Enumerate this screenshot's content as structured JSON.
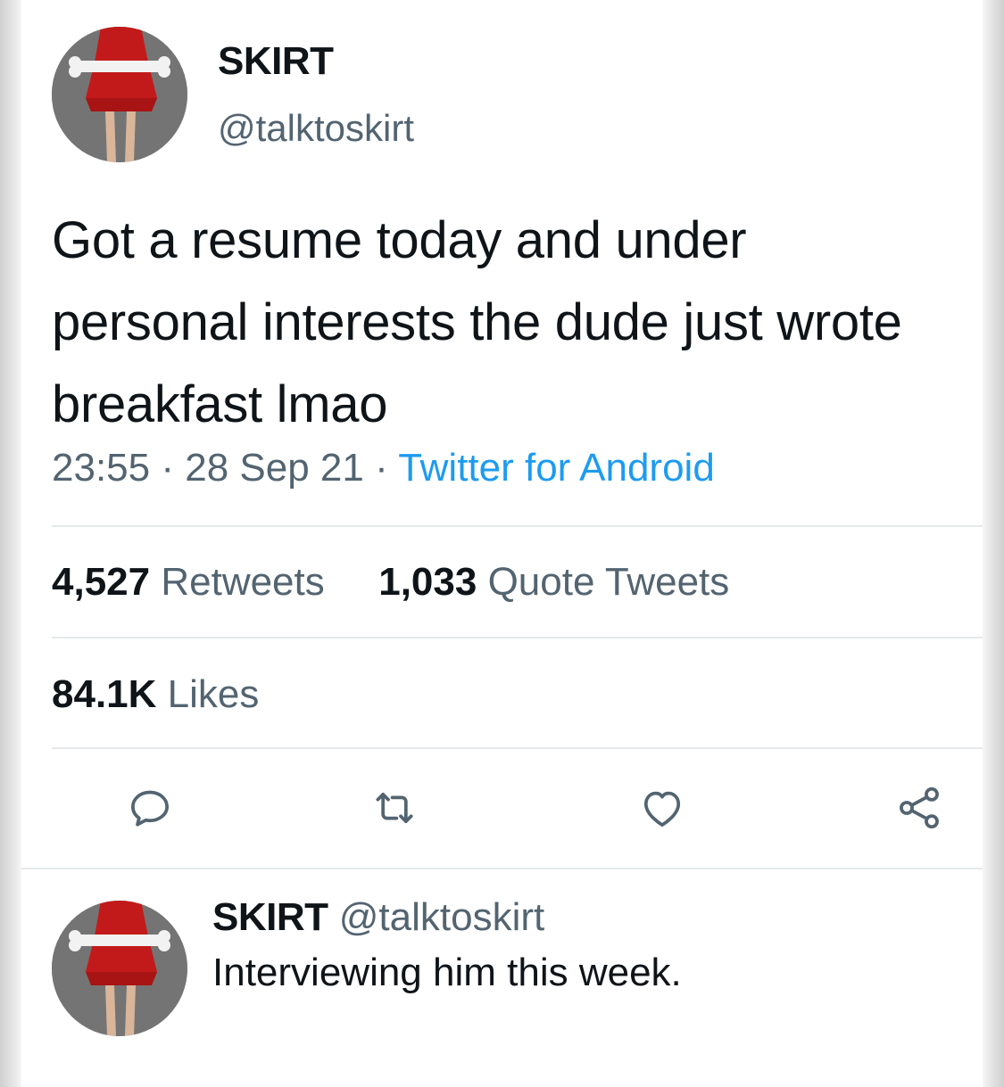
{
  "tweet": {
    "author_name": "SKIRT",
    "author_handle": "@talktoskirt",
    "text": "Got a resume today and under personal interests the dude just wrote breakfast lmao",
    "time": "23:55",
    "date": "28 Sep 21",
    "separator": "·",
    "source": "Twitter for Android",
    "retweets_count": "4,527",
    "retweets_label": "Retweets",
    "quotes_count": "1,033",
    "quotes_label": "Quote Tweets",
    "likes_count": "84.1K",
    "likes_label": "Likes"
  },
  "actions": {
    "icons": [
      "reply-icon",
      "retweet-icon",
      "like-icon",
      "share-icon"
    ]
  },
  "reply": {
    "author_name": "SKIRT",
    "author_handle": "@talktoskirt",
    "text": "Interviewing him this week."
  },
  "colors": {
    "text": "#0f1419",
    "secondary": "#536471",
    "link": "#1d9bf0",
    "divider": "#e6e9eb"
  }
}
